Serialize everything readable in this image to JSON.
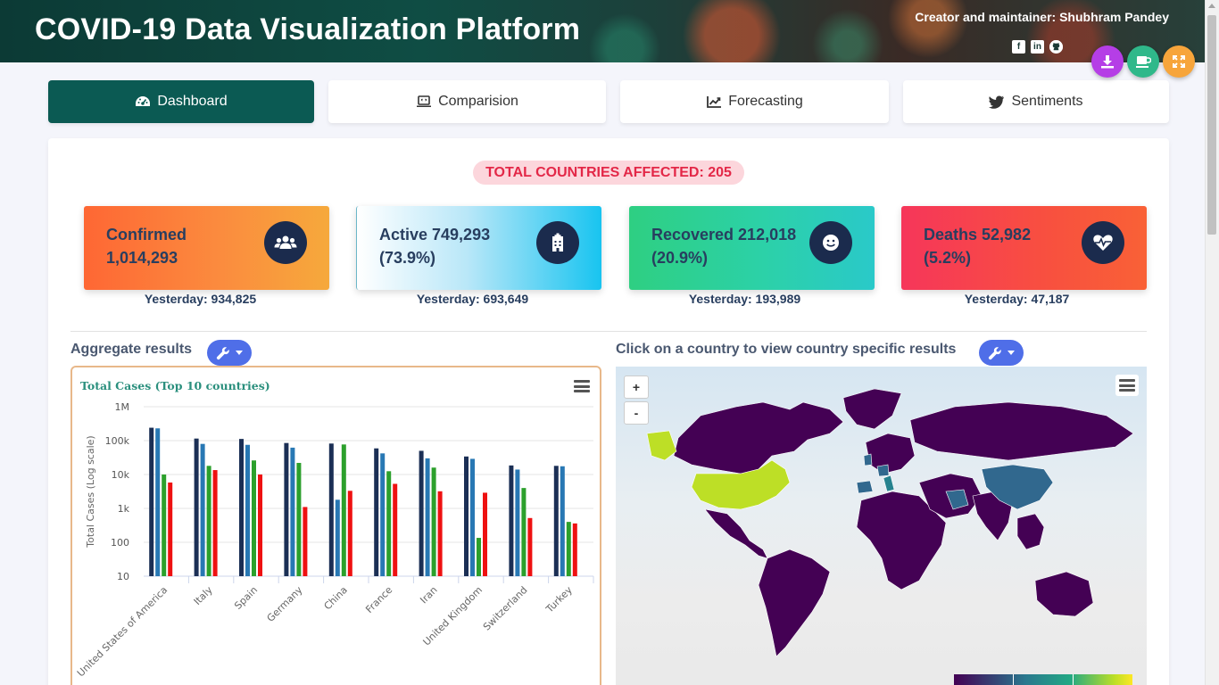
{
  "header": {
    "title": "COVID-19 Data Visualization Platform",
    "creator": "Creator and maintainer: Shubhram Pandey",
    "social": [
      "facebook-icon",
      "linkedin-icon",
      "github-icon"
    ]
  },
  "fabs": [
    "download-icon",
    "coffee-icon",
    "fullscreen-icon"
  ],
  "tabs": [
    {
      "label": "Dashboard",
      "icon": "gauge-icon",
      "active": true
    },
    {
      "label": "Comparision",
      "icon": "laptop-icon",
      "active": false
    },
    {
      "label": "Forecasting",
      "icon": "line-chart-icon",
      "active": false
    },
    {
      "label": "Sentiments",
      "icon": "twitter-icon",
      "active": false
    }
  ],
  "affected": "TOTAL COUNTRIES AFFECTED: 205",
  "stats": {
    "confirmed": {
      "line1": "Confirmed",
      "line2": "1,014,293",
      "yesterday": "Yesterday: 934,825",
      "icon": "users-icon"
    },
    "active": {
      "line1": "Active 749,293",
      "line2": "(73.9%)",
      "yesterday": "Yesterday: 693,649",
      "icon": "hospital-icon"
    },
    "recovered": {
      "line1": "Recovered 212,018",
      "line2": "(20.9%)",
      "yesterday": "Yesterday: 193,989",
      "icon": "smile-icon"
    },
    "deaths": {
      "line1": "Deaths 52,982",
      "line2": "(5.2%)",
      "yesterday": "Yesterday: 47,187",
      "icon": "heartbeat-icon"
    }
  },
  "sections": {
    "aggregate_title": "Aggregate results",
    "map_title": "Click on a country to view country specific results"
  },
  "map": {
    "zoom_in": "+",
    "zoom_out": "-"
  },
  "colors": {
    "series": [
      "#1b2f55",
      "#2878b4",
      "#2ca02c",
      "#ee1111"
    ]
  },
  "chart_data": {
    "type": "bar",
    "title": "Total Cases (Top 10 countries)",
    "ylabel": "Total Cases (Log scale)",
    "yscale": "log",
    "ylim": [
      10,
      1000000
    ],
    "yticks": [
      {
        "value": 10,
        "label": "10"
      },
      {
        "value": 100,
        "label": "100"
      },
      {
        "value": 1000,
        "label": "1k"
      },
      {
        "value": 10000,
        "label": "10k"
      },
      {
        "value": 100000,
        "label": "100k"
      },
      {
        "value": 1000000,
        "label": "1M"
      }
    ],
    "categories": [
      "United States of America",
      "Italy",
      "Spain",
      "Germany",
      "China",
      "France",
      "Iran",
      "United Kingdom",
      "Switzerland",
      "Turkey"
    ],
    "series": [
      {
        "values": [
          240000,
          115000,
          112000,
          85000,
          82000,
          59000,
          50000,
          34000,
          18500,
          18000
        ]
      },
      {
        "values": [
          230000,
          80000,
          75000,
          62000,
          1800,
          42000,
          30000,
          29000,
          14000,
          17500
        ]
      },
      {
        "values": [
          10000,
          18000,
          26000,
          22000,
          77000,
          12500,
          16000,
          135,
          4000,
          400
        ]
      },
      {
        "values": [
          5800,
          13500,
          10000,
          1100,
          3300,
          5300,
          3200,
          2900,
          520,
          360
        ]
      }
    ]
  }
}
